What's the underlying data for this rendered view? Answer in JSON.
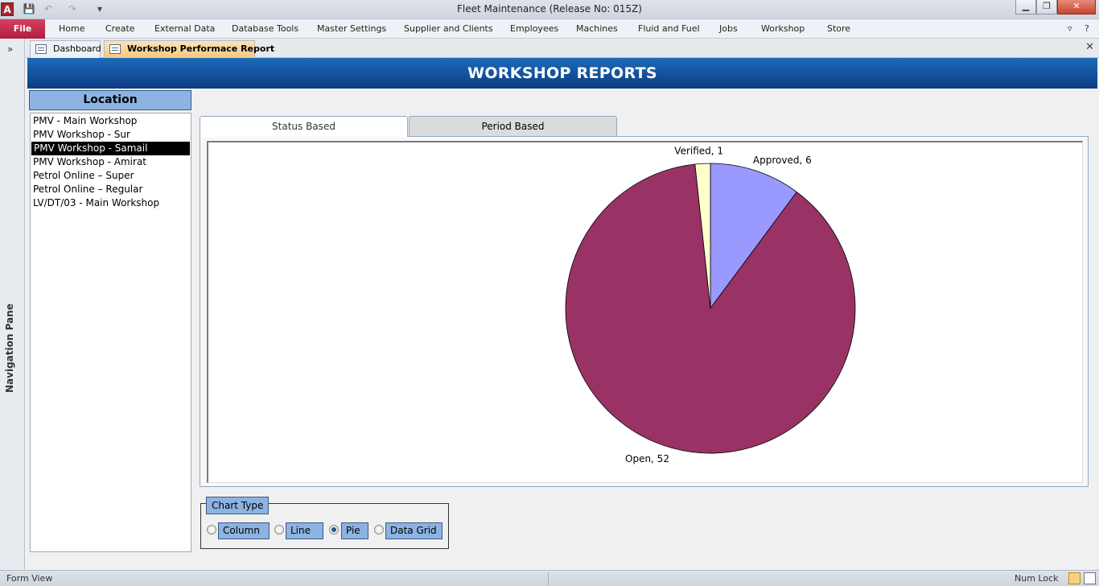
{
  "window": {
    "title": "Fleet Maintenance (Release No: 015Z)",
    "app_icon": "A"
  },
  "ribbon": {
    "file": "File",
    "tabs": [
      "Home",
      "Create",
      "External Data",
      "Database Tools",
      "Master Settings",
      "Supplier and Clients",
      "Employees",
      "Machines",
      "Fluid and Fuel",
      "Jobs",
      "Workshop",
      "Store"
    ]
  },
  "nav_pane": {
    "label": "Navigation Pane"
  },
  "doc_tabs": {
    "dashboard": "Dashboard",
    "report": "Workshop Performace Report"
  },
  "form": {
    "header": "WORKSHOP REPORTS",
    "location_header": "Location",
    "locations": [
      "PMV - Main Workshop",
      "PMV Workshop - Sur",
      "PMV Workshop - Samail",
      "PMV Workshop - Amirat",
      "Petrol Online – Super",
      "Petrol Online – Regular",
      "LV/DT/03 - Main Workshop"
    ],
    "selected_location": "PMV Workshop - Samail",
    "tabs": {
      "status": "Status Based",
      "period": "Period Based"
    },
    "chart_type": {
      "legend": "Chart Type",
      "options": [
        "Column",
        "Line",
        "Pie",
        "Data Grid"
      ],
      "selected": "Pie"
    }
  },
  "chart_data": {
    "type": "pie",
    "categories": [
      "Approved",
      "Open",
      "Verified"
    ],
    "values": [
      6,
      52,
      1
    ],
    "labels": [
      "Approved, 6",
      "Open, 52",
      "Verified, 1"
    ],
    "colors": [
      "#9999ff",
      "#993366",
      "#ffffcc"
    ]
  },
  "statusbar": {
    "view": "Form View",
    "numlock": "Num Lock"
  }
}
